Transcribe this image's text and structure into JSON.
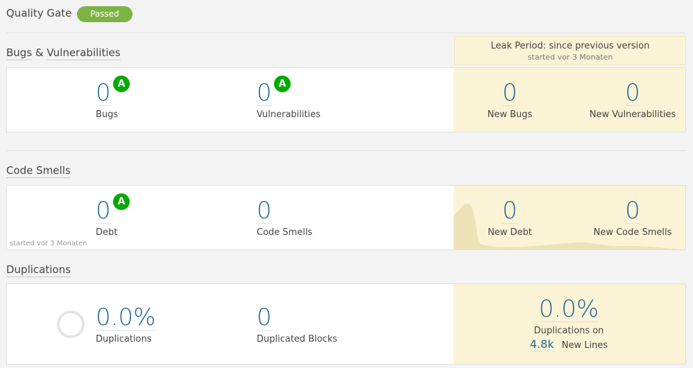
{
  "quality_gate": {
    "title": "Quality Gate",
    "status": "Passed",
    "status_color": "#7cb342"
  },
  "leak_period": {
    "title": "Leak Period: since previous version",
    "subtitle": "started vor 3 Monaten"
  },
  "bugs_vulns": {
    "title_part1": "Bugs",
    "title_sep": "&",
    "title_part2": "Vulnerabilities",
    "bugs": {
      "value": "0",
      "label": "Bugs",
      "rating": "A"
    },
    "vulnerabilities": {
      "value": "0",
      "label": "Vulnerabilities",
      "rating": "A"
    },
    "new_bugs": {
      "value": "0",
      "label": "New Bugs"
    },
    "new_vulnerabilities": {
      "value": "0",
      "label": "New Vulnerabilities"
    }
  },
  "code_smells": {
    "title": "Code Smells",
    "debt": {
      "value": "0",
      "label": "Debt",
      "rating": "A"
    },
    "smells": {
      "value": "0",
      "label": "Code Smells"
    },
    "new_debt": {
      "value": "0",
      "label": "New Debt"
    },
    "new_smells": {
      "value": "0",
      "label": "New Code Smells"
    },
    "history_note": "started vor 3 Monaten"
  },
  "duplications": {
    "title": "Duplications",
    "density": {
      "value": "0.0%",
      "label": "Duplications"
    },
    "blocks": {
      "value": "0",
      "label": "Duplicated Blocks"
    },
    "new_density": {
      "value": "0.0%",
      "label": "Duplications on",
      "new_lines_value": "4.8k",
      "new_lines_label": "New Lines"
    }
  },
  "colors": {
    "accent": "#236a97",
    "rating_a": "#00aa00",
    "leak_bg": "#fbf3d5",
    "chart_fill": "#ede2b6"
  }
}
